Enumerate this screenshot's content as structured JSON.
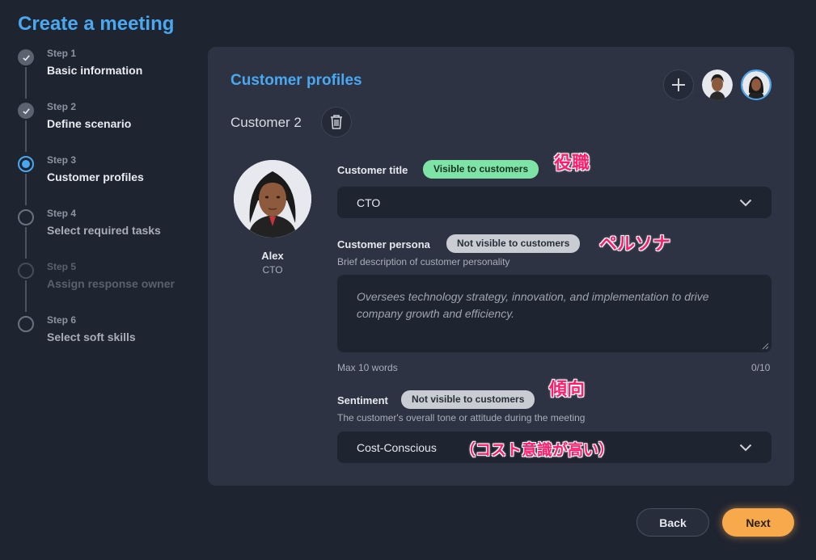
{
  "page": {
    "title": "Create a meeting"
  },
  "steps": [
    {
      "num": "Step 1",
      "label": "Basic information",
      "state": "done"
    },
    {
      "num": "Step 2",
      "label": "Define scenario",
      "state": "done"
    },
    {
      "num": "Step 3",
      "label": "Customer profiles",
      "state": "current"
    },
    {
      "num": "Step 4",
      "label": "Select required tasks",
      "state": "todo"
    },
    {
      "num": "Step 5",
      "label": "Assign response owner",
      "state": "disabled"
    },
    {
      "num": "Step 6",
      "label": "Select soft skills",
      "state": "todo"
    }
  ],
  "card": {
    "title": "Customer profiles",
    "customer_name": "Customer 2",
    "avatar": {
      "name": "Alex",
      "role": "CTO"
    },
    "customer_title": {
      "label": "Customer title",
      "visibility": "Visible to customers",
      "value": "CTO",
      "annotation": "役職"
    },
    "persona": {
      "label": "Customer persona",
      "visibility": "Not visible to customers",
      "help": "Brief description of customer personality",
      "text": "Oversees technology strategy, innovation, and implementation to drive company growth and efficiency.",
      "limit": "Max 10 words",
      "count": "0/10",
      "annotation": "ペルソナ"
    },
    "sentiment": {
      "label": "Sentiment",
      "visibility": "Not visible to customers",
      "help": "The customer's overall tone or attitude during the meeting",
      "value": "Cost-Conscious",
      "annotation": "傾向",
      "value_annotation": "（コスト意識が高い）"
    }
  },
  "footer": {
    "back": "Back",
    "next": "Next"
  },
  "colors": {
    "accent": "#4aa8f0",
    "next": "#f7a94b",
    "visible_pill": "#7ee3a6",
    "hidden_pill": "#c9ccd3",
    "annotation": "#ff1d6b"
  },
  "icons": [
    "check-icon",
    "plus-icon",
    "trash-icon",
    "chevron-down-icon"
  ]
}
